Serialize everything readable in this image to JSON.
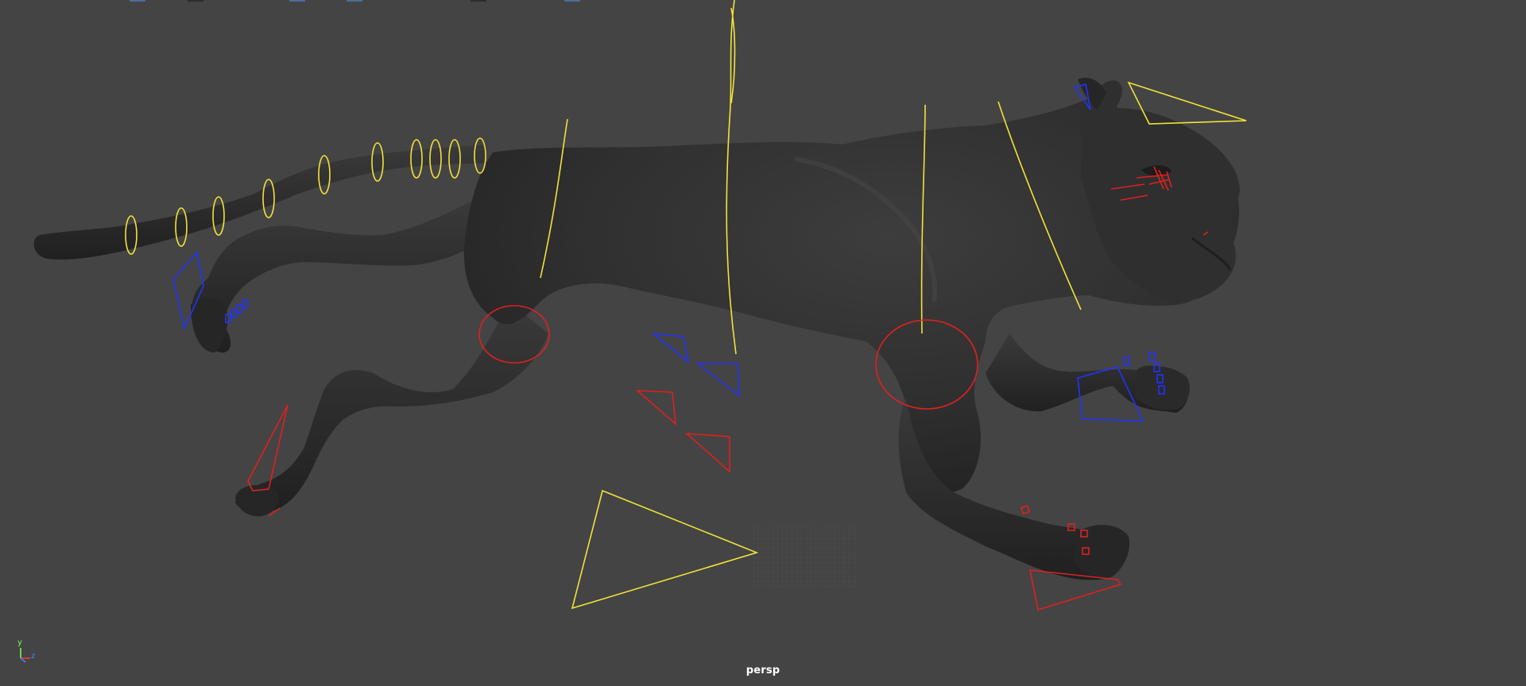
{
  "viewport": {
    "camera_label": "persp",
    "background_color": "#444444"
  },
  "axis_gizmo": {
    "y_label": "y",
    "z_label": "z",
    "x_color": "#ff3a3a",
    "y_color": "#7dff5a",
    "z_color": "#4c7dff"
  },
  "rig": {
    "model": "panther",
    "model_color": "#2e2e2e",
    "fk_control_color": "#f2e23a",
    "ik_left_control_color": "#2233ff",
    "ik_right_control_color": "#e02020",
    "grid_color": "#5a5a5a"
  }
}
